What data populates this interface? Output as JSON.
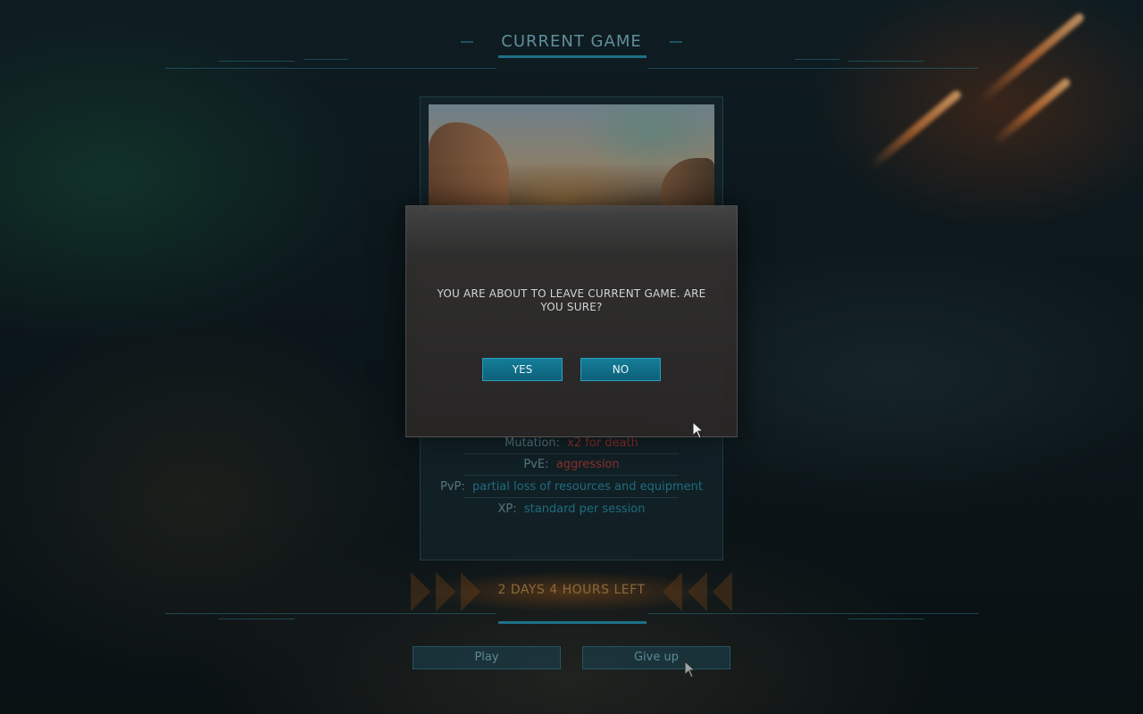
{
  "header": {
    "title": "CURRENT GAME"
  },
  "game_card": {
    "image_icon": "game-scene-image",
    "rules": [
      {
        "label": "Mutation:",
        "value": "x2 for death",
        "value_color": "#8c2f2a"
      },
      {
        "label": "PvE:",
        "value": "aggression",
        "value_color": "#8c2f2a"
      },
      {
        "label": "PvP:",
        "value": "partial loss of resources and equipment",
        "value_color": "#1f6c80"
      },
      {
        "label": "XP:",
        "value": "standard per session",
        "value_color": "#1f6c80"
      }
    ]
  },
  "timer": {
    "text": "2 DAYS 4 HOURS LEFT"
  },
  "actions": {
    "play_label": "Play",
    "give_up_label": "Give up"
  },
  "dialog": {
    "message": "YOU ARE ABOUT TO LEAVE CURRENT GAME. ARE YOU SURE?",
    "yes_label": "YES",
    "no_label": "NO"
  },
  "colors": {
    "accent": "#157d98",
    "danger_text": "#8c2f2a",
    "info_text": "#1f6c80"
  }
}
